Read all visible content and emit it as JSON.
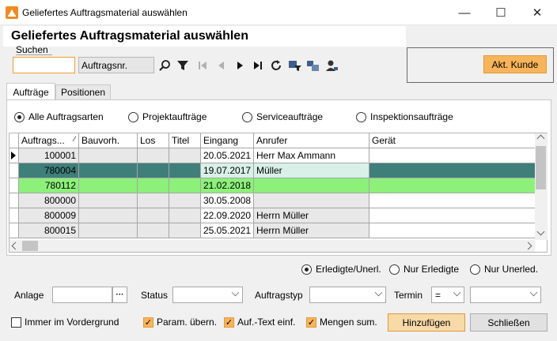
{
  "window": {
    "title": "Geliefertes Auftragsmaterial auswählen",
    "minimize": "—",
    "maximize": "☐",
    "close": "✕"
  },
  "header": {
    "title": "Geliefertes Auftragsmaterial auswählen"
  },
  "search": {
    "label": "Suchen",
    "value": "",
    "field": "Auftragsnr."
  },
  "actions": {
    "akt_kunde": "Akt. Kunde"
  },
  "tabs": [
    {
      "label": "Aufträge",
      "active": true
    },
    {
      "label": "Positionen",
      "active": false
    }
  ],
  "order_types": [
    {
      "label": "Alle Auftragsarten",
      "selected": true
    },
    {
      "label": "Projektaufträge",
      "selected": false
    },
    {
      "label": "Serviceaufträge",
      "selected": false
    },
    {
      "label": "Inspektionsaufträge",
      "selected": false
    }
  ],
  "grid": {
    "columns": [
      "Auftrags...",
      "Bauvorh.",
      "Los",
      "Titel",
      "Eingang",
      "Anrufer",
      "Gerät"
    ],
    "rows": [
      {
        "nr": "100001",
        "bauvorh": "",
        "los": "",
        "titel": "",
        "eingang": "20.05.2021",
        "anrufer": "Herr Max Ammann",
        "geraet": "",
        "style": "current"
      },
      {
        "nr": "780004",
        "bauvorh": "",
        "los": "",
        "titel": "",
        "eingang": "19.07.2017",
        "anrufer": "Müller",
        "geraet": "",
        "style": "teal"
      },
      {
        "nr": "780112",
        "bauvorh": "",
        "los": "",
        "titel": "",
        "eingang": "21.02.2018",
        "anrufer": "",
        "geraet": "",
        "style": "green"
      },
      {
        "nr": "800000",
        "bauvorh": "",
        "los": "",
        "titel": "",
        "eingang": "30.05.2008",
        "anrufer": "",
        "geraet": "",
        "style": "plain"
      },
      {
        "nr": "800009",
        "bauvorh": "",
        "los": "",
        "titel": "",
        "eingang": "22.09.2020",
        "anrufer": "Herrn Müller",
        "geraet": "",
        "style": "plain"
      },
      {
        "nr": "800015",
        "bauvorh": "",
        "los": "",
        "titel": "",
        "eingang": "25.05.2021",
        "anrufer": "Herrn Müller",
        "geraet": "",
        "style": "plain"
      }
    ]
  },
  "status_filter": [
    {
      "label": "Erledigte/Unerl.",
      "selected": true
    },
    {
      "label": "Nur Erledigte",
      "selected": false
    },
    {
      "label": "Nur Unerled.",
      "selected": false
    }
  ],
  "filters": {
    "anlage": "Anlage",
    "anlage_button": "···",
    "status": "Status",
    "auftragstyp": "Auftragstyp",
    "termin": "Termin",
    "termin_operator": "="
  },
  "footer": {
    "always_on_top": "Immer im Vordergrund",
    "param_uebern": "Param. übern.",
    "auf_text": "Auf.-Text einf.",
    "mengen_sum": "Mengen sum.",
    "hinzufuegen": "Hinzufügen",
    "schliessen": "Schließen"
  },
  "colors": {
    "accent": "#f8b45a",
    "teal_row": "#3f7f7a",
    "green_row": "#8cf07a"
  }
}
